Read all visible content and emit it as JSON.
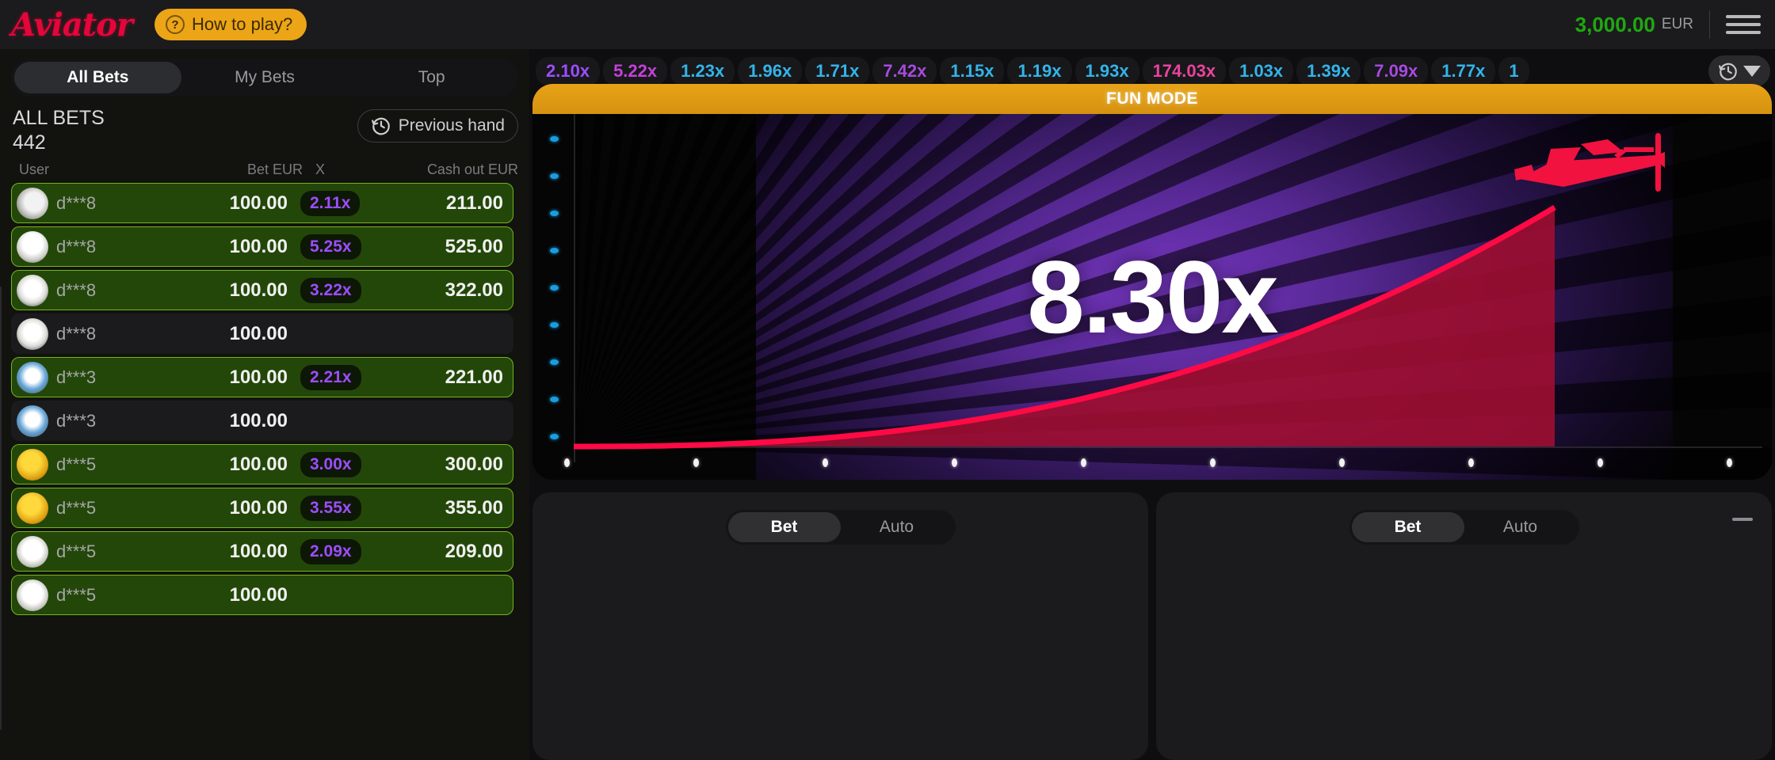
{
  "header": {
    "logo_text": "Aviator",
    "how_to_play_label": "How to play?",
    "question_icon": "question-mark-icon",
    "balance_amount": "3,000.00",
    "balance_currency": "EUR",
    "menu_icon": "hamburger-menu-icon",
    "balance_color": "#1fa811",
    "brand_color": "#e50539",
    "accent_color": "#eca516"
  },
  "bets_panel": {
    "tabs": [
      {
        "label": "All Bets",
        "active": true
      },
      {
        "label": "My Bets",
        "active": false
      },
      {
        "label": "Top",
        "active": false
      }
    ],
    "section_label": "ALL BETS",
    "section_count": "442",
    "previous_hand_label": "Previous hand",
    "previous_hand_icon": "history-clock-icon",
    "columns": {
      "user": "User",
      "bet": "Bet EUR",
      "x": "X",
      "cashout": "Cash out EUR"
    },
    "rows": [
      {
        "avatar": "av-eagle",
        "user": "d***8",
        "bet": "100.00",
        "mult": "2.11x",
        "cashout": "211.00",
        "won": true
      },
      {
        "avatar": "av-eagle2",
        "user": "d***8",
        "bet": "100.00",
        "mult": "5.25x",
        "cashout": "525.00",
        "won": true
      },
      {
        "avatar": "av-shark",
        "user": "d***8",
        "bet": "100.00",
        "mult": "3.22x",
        "cashout": "322.00",
        "won": true
      },
      {
        "avatar": "av-shark",
        "user": "d***8",
        "bet": "100.00",
        "mult": "",
        "cashout": "",
        "won": false
      },
      {
        "avatar": "av-plane",
        "user": "d***3",
        "bet": "100.00",
        "mult": "2.21x",
        "cashout": "221.00",
        "won": true
      },
      {
        "avatar": "av-plane",
        "user": "d***3",
        "bet": "100.00",
        "mult": "",
        "cashout": "",
        "won": false
      },
      {
        "avatar": "av-gold",
        "user": "d***5",
        "bet": "100.00",
        "mult": "3.00x",
        "cashout": "300.00",
        "won": true
      },
      {
        "avatar": "av-gold",
        "user": "d***5",
        "bet": "100.00",
        "mult": "3.55x",
        "cashout": "355.00",
        "won": true
      },
      {
        "avatar": "av-vulture",
        "user": "d***5",
        "bet": "100.00",
        "mult": "2.09x",
        "cashout": "209.00",
        "won": true
      },
      {
        "avatar": "av-vulture",
        "user": "d***5",
        "bet": "100.00",
        "mult": "",
        "cashout": "",
        "won": true
      }
    ]
  },
  "history": {
    "items": [
      {
        "value": "2.10x",
        "color": "#9b4dff"
      },
      {
        "value": "5.22x",
        "color": "#c341d8"
      },
      {
        "value": "1.23x",
        "color": "#34b3e8"
      },
      {
        "value": "1.96x",
        "color": "#34b3e8"
      },
      {
        "value": "1.71x",
        "color": "#34b3e8"
      },
      {
        "value": "7.42x",
        "color": "#a64ae0"
      },
      {
        "value": "1.15x",
        "color": "#34b3e8"
      },
      {
        "value": "1.19x",
        "color": "#34b3e8"
      },
      {
        "value": "1.93x",
        "color": "#34b3e8"
      },
      {
        "value": "174.03x",
        "color": "#e8449e"
      },
      {
        "value": "1.03x",
        "color": "#34b3e8"
      },
      {
        "value": "1.39x",
        "color": "#34b3e8"
      },
      {
        "value": "7.09x",
        "color": "#a64ae0"
      },
      {
        "value": "1.77x",
        "color": "#34b3e8"
      },
      {
        "value": "1",
        "color": "#34b3e8"
      }
    ],
    "toggle_icon": "history-clock-icon",
    "caret_icon": "chevron-down-icon"
  },
  "game": {
    "mode_banner": "FUN MODE",
    "current_multiplier": "8.30x",
    "plane_icon": "red-airplane-icon",
    "curve_color": "#ff0a45",
    "fill_color": "#9c0e31"
  },
  "bet_panels": [
    {
      "tabs": [
        {
          "label": "Bet",
          "active": true
        },
        {
          "label": "Auto",
          "active": false
        }
      ],
      "has_minus": false
    },
    {
      "tabs": [
        {
          "label": "Bet",
          "active": true
        },
        {
          "label": "Auto",
          "active": false
        }
      ],
      "has_minus": true,
      "minus_icon": "minus-icon"
    }
  ]
}
